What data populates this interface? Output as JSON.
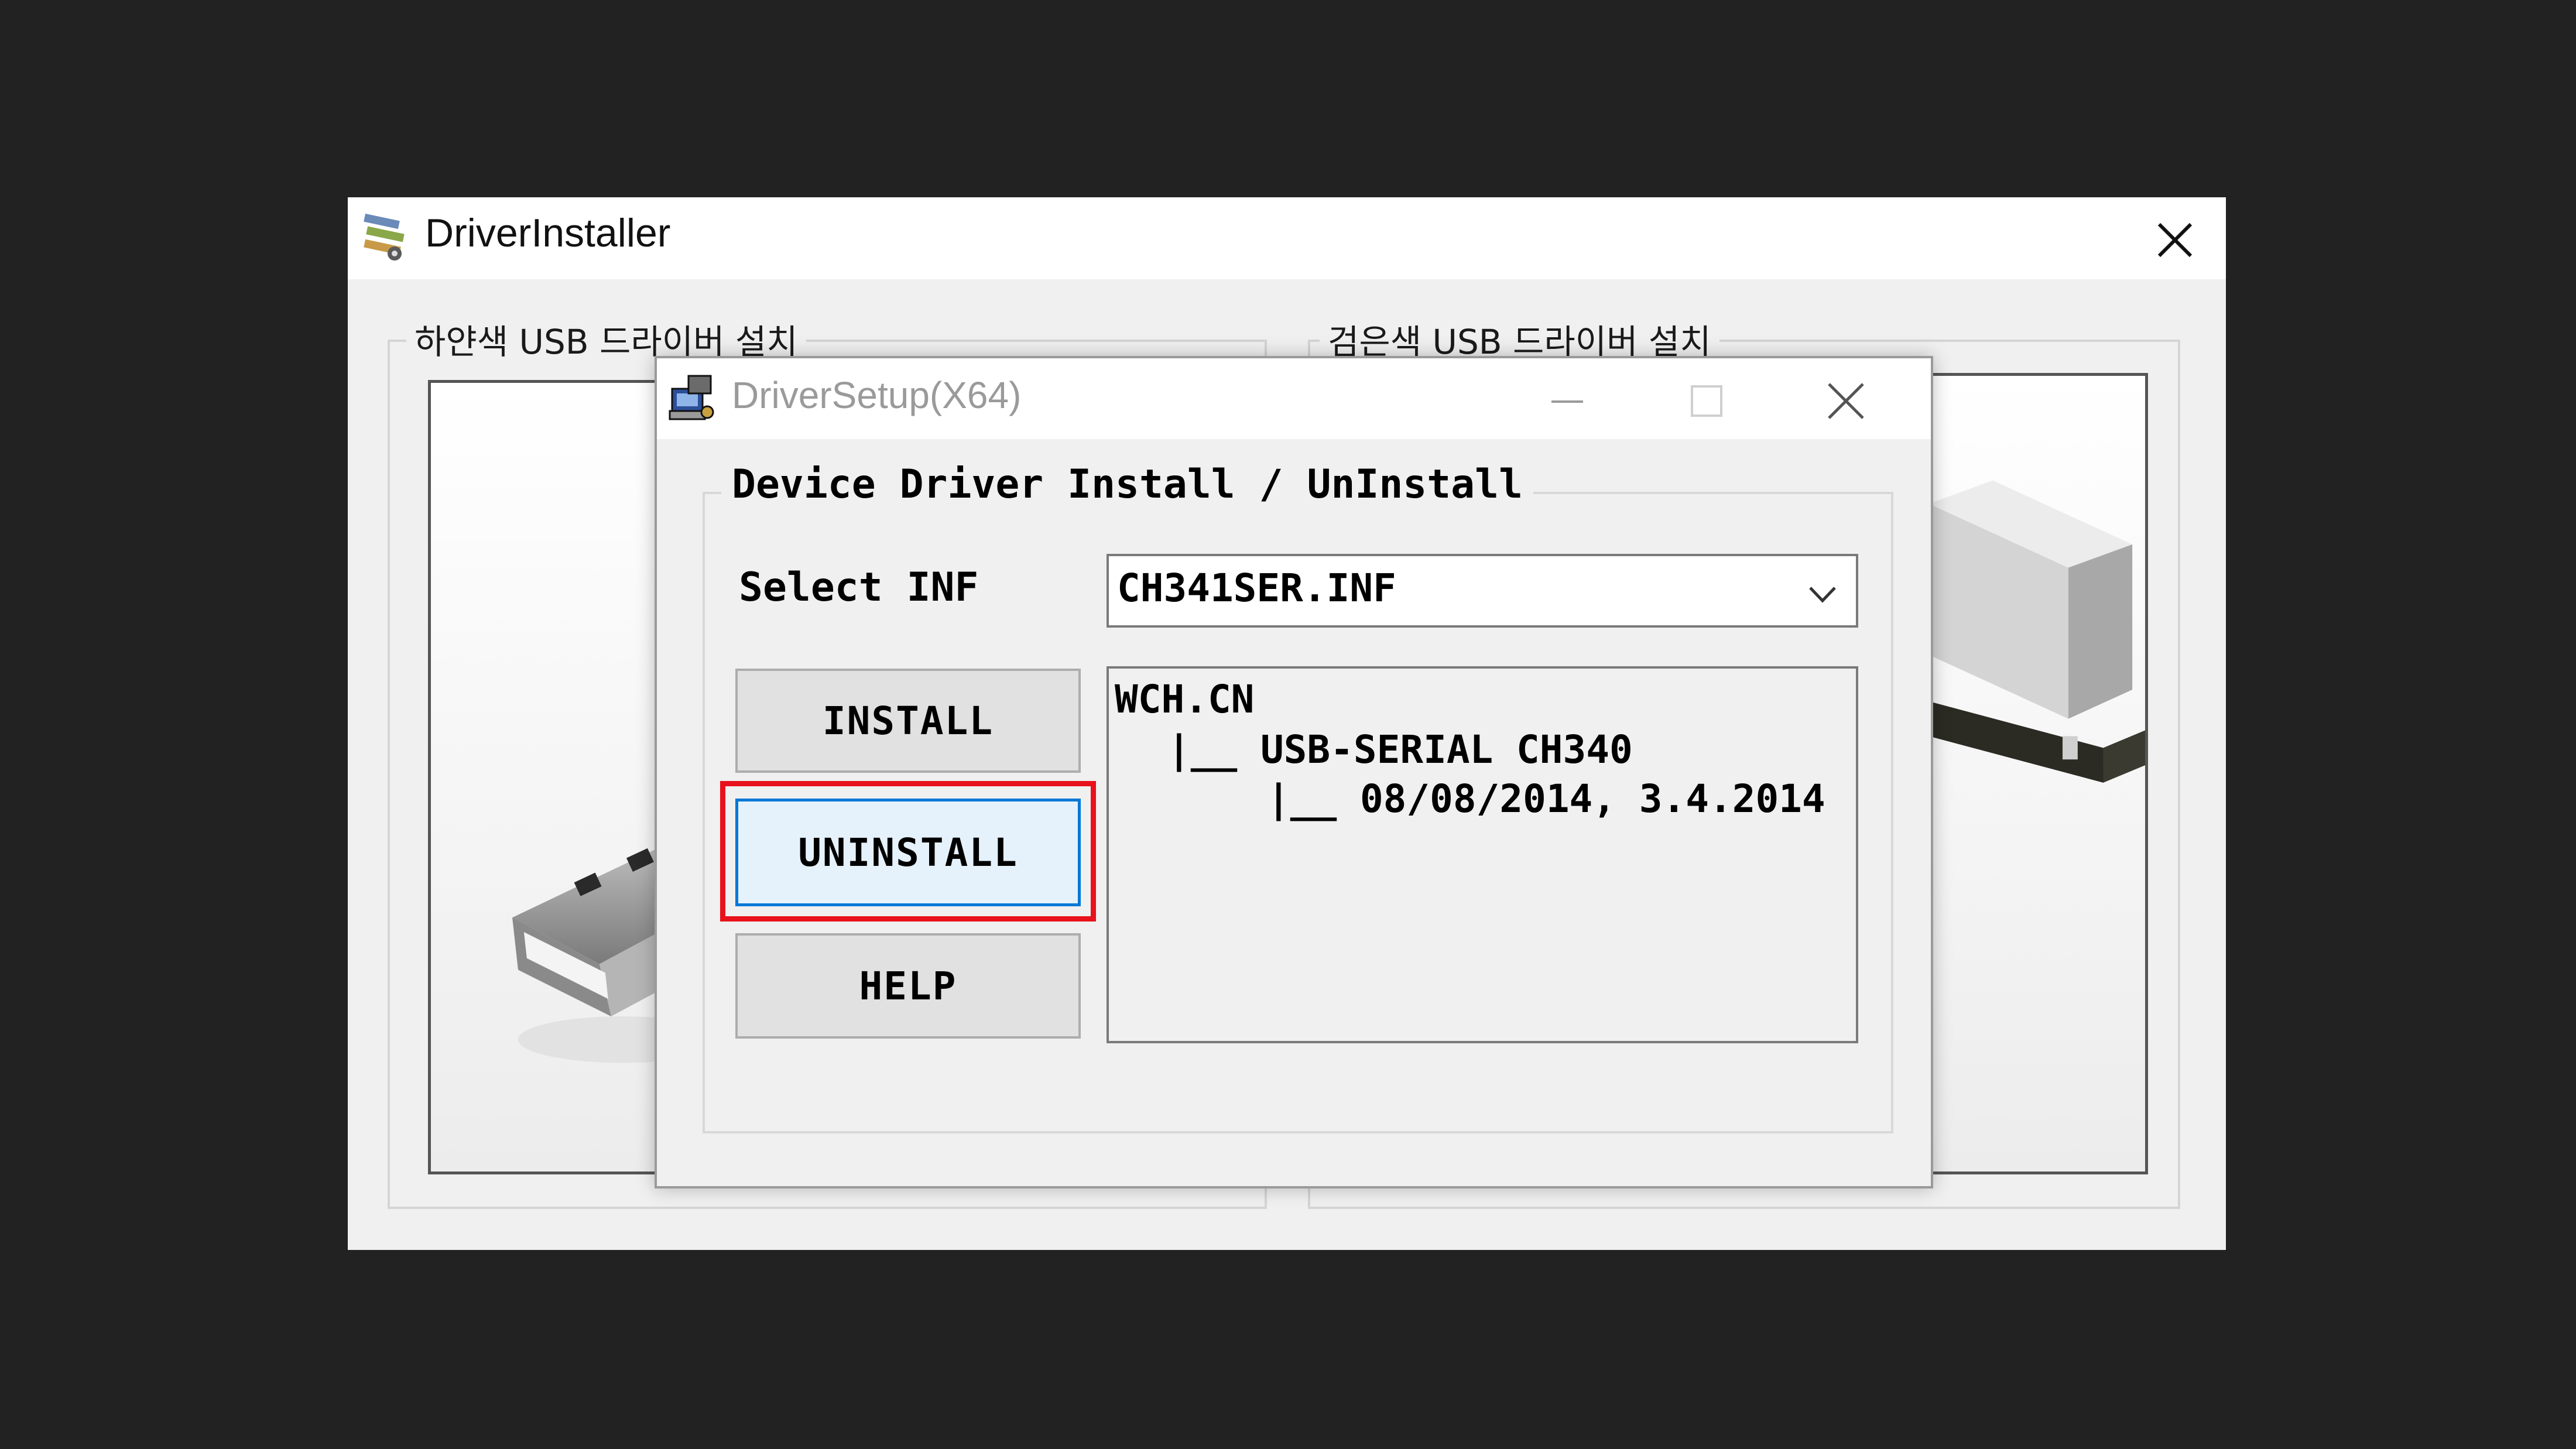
{
  "outer_window": {
    "title": "DriverInstaller",
    "icon": "driver-installer-icon",
    "groups": {
      "white_label": "하얀색 USB 드라이버 설치",
      "black_label": "검은색 USB 드라이버 설치"
    }
  },
  "dialog": {
    "title": "DriverSetup(X64)",
    "icon": "driver-setup-icon",
    "group_label": "Device Driver Install / UnInstall",
    "select_label": "Select INF",
    "inf_value": "CH341SER.INF",
    "buttons": {
      "install": "INSTALL",
      "uninstall": "UNINSTALL",
      "help": "HELP"
    },
    "info": {
      "line1": "WCH.CN",
      "line2": "|__ USB-SERIAL CH340",
      "line3": "|__ 08/08/2014, 3.4.2014"
    }
  },
  "colors": {
    "highlight": "#e8121c",
    "focus_border": "#0078d7",
    "background": "#222222"
  }
}
